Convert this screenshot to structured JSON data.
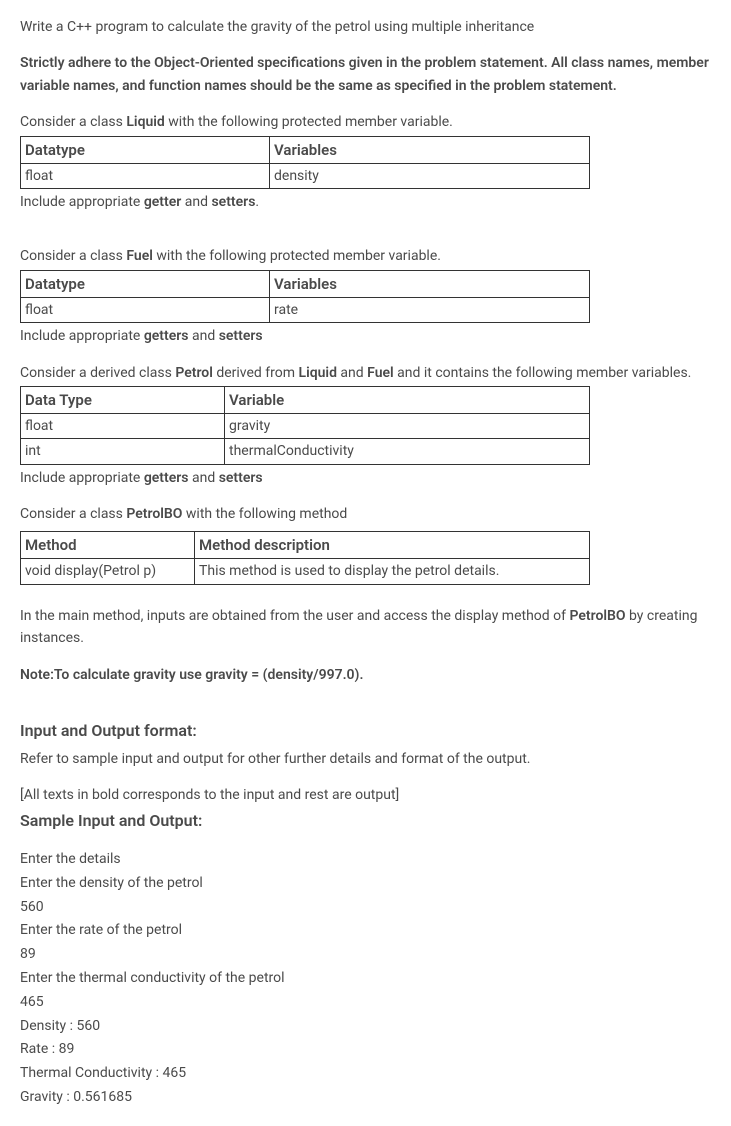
{
  "intro": "Write a C++ program to calculate the gravity of the petrol using multiple inheritance",
  "strict_note": "Strictly adhere to the Object-Oriented specifications given in the problem statement. All class names, member variable names, and function names should be the same as specified in the problem statement.",
  "liquid": {
    "prefix": "Consider a class ",
    "class_name": "Liquid",
    "suffix": " with the following protected member variable.",
    "headers": [
      "Datatype",
      "Variables"
    ],
    "rows": [
      [
        "float",
        "density"
      ]
    ],
    "after_prefix": "Include appropriate ",
    "after_bold1": "getter",
    "after_mid": " and ",
    "after_bold2": "setters",
    "after_suffix": "."
  },
  "fuel": {
    "prefix": "Consider a class ",
    "class_name": "Fuel",
    "suffix": " with the following protected member variable.",
    "headers": [
      "Datatype",
      "Variables"
    ],
    "rows": [
      [
        "float",
        "rate"
      ]
    ],
    "after_prefix": "Include appropriate ",
    "after_bold1": "getters",
    "after_mid": " and ",
    "after_bold2": "setters",
    "after_suffix": ""
  },
  "petrol": {
    "prefix": "Consider a derived class ",
    "class_name": "Petrol",
    "mid1": " derived from ",
    "parent1": "Liquid",
    "mid2": " and ",
    "parent2": "Fuel",
    "suffix": " and it contains the following member variables.",
    "headers": [
      "Data Type",
      "Variable"
    ],
    "rows": [
      [
        "float",
        "gravity"
      ],
      [
        "int",
        "thermalConductivity"
      ]
    ],
    "after_prefix": "Include appropriate ",
    "after_bold1": "getters",
    "after_mid": " and ",
    "after_bold2": "setters",
    "after_suffix": ""
  },
  "petrolbo": {
    "prefix": "Consider a class ",
    "class_name": "PetrolBO",
    "suffix": " with the following method",
    "headers": [
      "Method",
      "Method description"
    ],
    "rows": [
      [
        "void display(Petrol p)",
        "This method is used to display the petrol details."
      ]
    ]
  },
  "main_note_prefix": "In the main method, inputs are obtained from the user and access the display method of ",
  "main_note_bold": "PetrolBO",
  "main_note_suffix": " by creating instances.",
  "gravity_note": "Note:To calculate gravity use gravity = (density/997.0).",
  "io_heading": "Input and Output format:",
  "io_text": "Refer to sample input and output for other further details and format of the output.",
  "bold_note": "[All texts in bold corresponds to the input and rest are output]",
  "sample_heading": "Sample Input and Output:",
  "sample": [
    "Enter the details",
    "Enter the density of the petrol",
    "560",
    "Enter the rate of the petrol",
    "89",
    "Enter the thermal conductivity of the petrol",
    "465",
    "Density : 560",
    "Rate : 89",
    "Thermal Conductivity : 465",
    "Gravity : 0.561685"
  ]
}
